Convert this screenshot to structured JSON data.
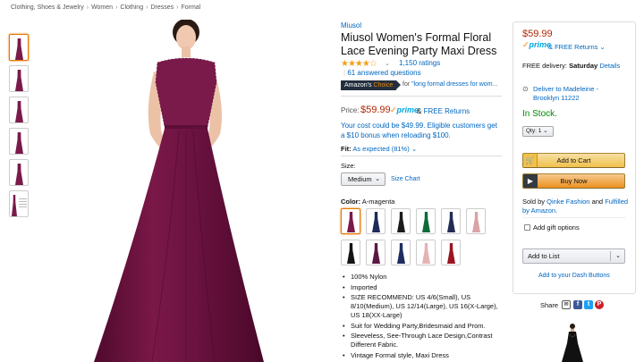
{
  "breadcrumb": [
    "Clothing, Shoes & Jewelry",
    "Women",
    "Clothing",
    "Dresses",
    "Formal"
  ],
  "breadcrumb_sep": "›",
  "product": {
    "brand": "Miusol",
    "title": "Miusol Women's Formal Floral Lace Evening Party Maxi Dress",
    "stars": "★★★★☆",
    "rating_value": 4.5,
    "ratings_count": "1,150 ratings",
    "answered": "61 answered questions",
    "answered_sep": "|",
    "choice_badge_prefix": "Amazon's",
    "choice_badge_word": "Choice",
    "choice_for": "for",
    "choice_query": "\"long formal dresses for wom..."
  },
  "price": {
    "label": "Price:",
    "value": "$59.99",
    "prime_check": "✓",
    "prime": "prime",
    "amp": "&",
    "free_returns": "FREE Returns",
    "bonus": "Your cost could be $49.99. Eligible customers get a $10 bonus when reloading $100."
  },
  "fit": {
    "label": "Fit:",
    "value": "As expected (81%)",
    "caret": "⌄"
  },
  "size": {
    "label": "Size:",
    "selected": "Medium",
    "caret": "⌄",
    "chart_link": "Size Chart"
  },
  "color": {
    "label": "Color:",
    "selected": "A-magenta",
    "swatches": [
      {
        "name": "A-magenta",
        "hex": "#7a1a4a",
        "selected": true
      },
      {
        "name": "navy",
        "hex": "#1d2a5c"
      },
      {
        "name": "black",
        "hex": "#1a1a1a"
      },
      {
        "name": "green",
        "hex": "#0f6b3a"
      },
      {
        "name": "navy2",
        "hex": "#222b55"
      },
      {
        "name": "pink",
        "hex": "#d9a3a8"
      },
      {
        "name": "black2",
        "hex": "#141414"
      },
      {
        "name": "purple",
        "hex": "#5a1942"
      },
      {
        "name": "navy3",
        "hex": "#1e2c60"
      },
      {
        "name": "blush",
        "hex": "#e3b2b5"
      },
      {
        "name": "red",
        "hex": "#9a1420"
      }
    ]
  },
  "bullets": [
    "100% Nylon",
    "Imported",
    "SIZE RECOMMEND: US 4/6(Small), US 8/10(Medium), US 12/14(Large), US 16(X-Large), US 18(XX-Large)",
    "Suit for Wedding Party,Bridesmaid and Prom.",
    "Sleeveless, See-Through Lace Design,Contrast Different Fabric.",
    "Vintage Formal style, Maxi Dress"
  ],
  "buybox": {
    "price": "$59.99",
    "prime_check": "✓",
    "prime": "prime",
    "free_returns": "& FREE Returns",
    "free_caret": "⌄",
    "delivery_prefix": "FREE delivery:",
    "delivery_day": "Saturday",
    "delivery_details": "Details",
    "pin_icon": "⊙",
    "deliver_to": "Deliver to Madeleine - Brooklyn 11222",
    "stock": "In Stock.",
    "qty": "Qty: 1",
    "add_to_cart": "Add to Cart",
    "buy_now": "Buy Now",
    "sold_by_prefix": "Sold by",
    "seller": "Qinke Fashion",
    "and": "and",
    "fulfilled": "Fulfilled by Amazon.",
    "gift_options": "Add gift options",
    "add_to_list": "Add to List",
    "dash_buttons": "Add to your Dash Buttons"
  },
  "share": {
    "label": "Share",
    "mail_icon": "✉",
    "fb_icon": "f",
    "tw_icon": "t",
    "pin_icon": "P"
  },
  "colors": {
    "dress": "#6f1240",
    "dress_dark": "#4f0a2c",
    "price": "#b12704",
    "link": "#0066c0",
    "stock": "#008a00",
    "prime": "#00a8e1"
  }
}
